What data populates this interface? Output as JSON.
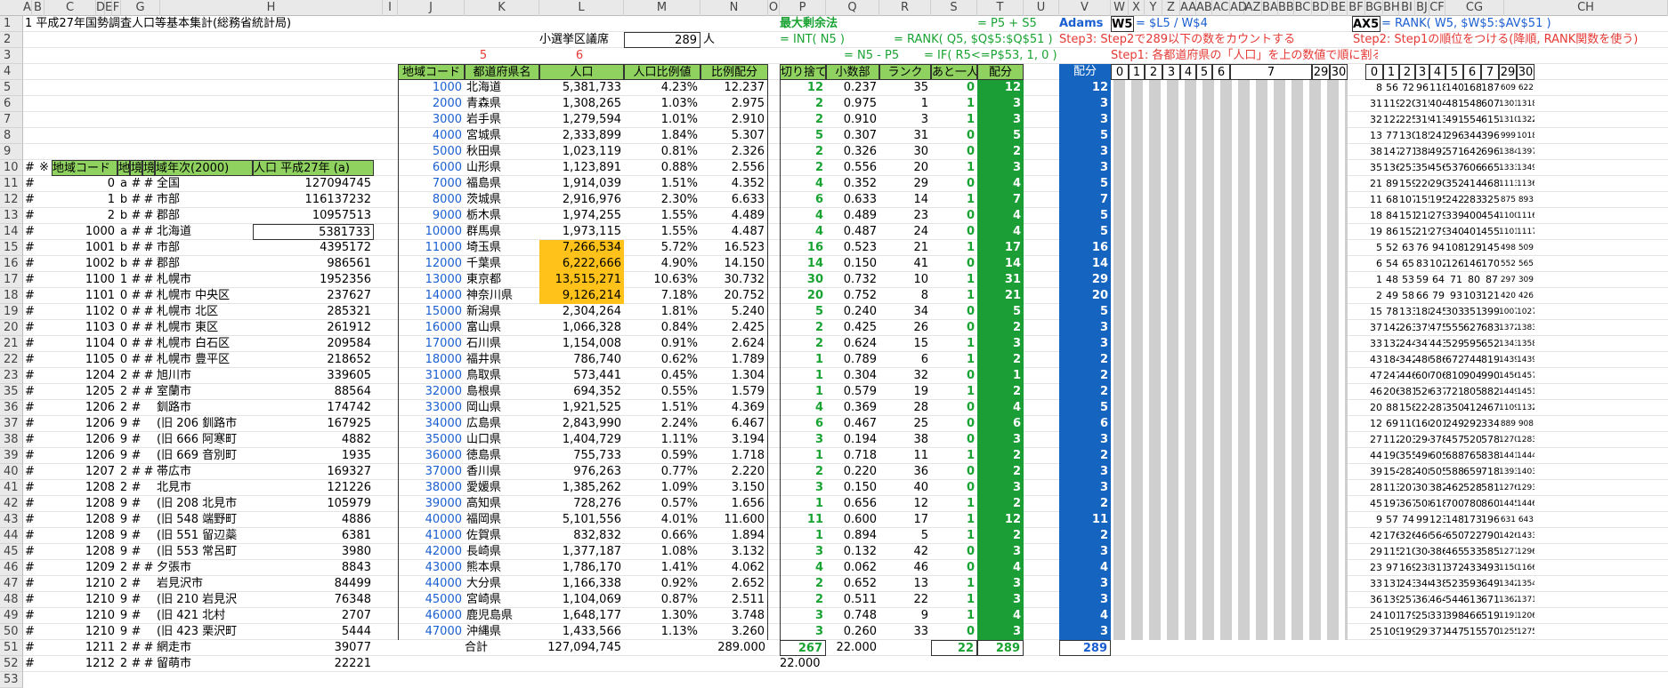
{
  "colheaders": [
    "A",
    "B",
    "C",
    "D",
    "E",
    "F",
    "G",
    "H",
    "I",
    "J",
    "K",
    "L",
    "M",
    "N",
    "O",
    "P",
    "Q",
    "R",
    "S",
    "T",
    "U",
    "V",
    "W",
    "X",
    "Y",
    "Z",
    "AA",
    "AB",
    "AC",
    "AD",
    "AZ",
    "BA",
    "BB",
    "BC",
    "BD",
    "BE",
    "BF",
    "BG",
    "BH",
    "BI",
    "BJ",
    "CF",
    "CG",
    "CH"
  ],
  "rows": [
    "1",
    "2",
    "3",
    "4",
    "5",
    "6",
    "7",
    "8",
    "9",
    "10",
    "11",
    "12",
    "13",
    "14",
    "15",
    "16",
    "17",
    "18",
    "19",
    "20",
    "21",
    "22",
    "23",
    "35",
    "36",
    "37",
    "38",
    "39",
    "40",
    "41",
    "42",
    "43",
    "44",
    "45",
    "46",
    "47",
    "48",
    "49",
    "50",
    "51",
    "52",
    "53"
  ],
  "title": "1  平成27年国勢調査人口等基本集計(総務省統計局)",
  "seat_label": "小選挙区議席",
  "seats": "289",
  "seat_unit": "人",
  "marker5": "5",
  "marker6": "6",
  "tbl_hdr": {
    "code": "地域コード",
    "pref": "都道府県名",
    "pop": "人口",
    "ratio": "人口比例値",
    "prop": "比例配分",
    "floor": "切り捨て",
    "frac": "小数部",
    "rank": "ランク",
    "more": "あと一人？",
    "alloc": "配分",
    "adams": "配分"
  },
  "sec_max": "最大剰余法",
  "f_p5s5": "= P5 + S5",
  "f_int": "= INT( N5 )",
  "f_rank": "= RANK( Q5, $Q$5:$Q$51 )",
  "f_n5p5": "= N5 - P5",
  "f_if": "= IF( R5<=P$53, 1, 0 )",
  "adams_label": "Adams",
  "w5": "W5",
  "f_w5": "= $L5 / W$4",
  "ax5": "AX5",
  "f_ax5": "= RANK( W5, $W$5:$AV$51 )",
  "step3": "Step3: Step2で289以下の数をカウントする",
  "step2": "Step2: Step1の順位をつける(降順, RANK関数を使う)",
  "step1": "Step1: 各都道府県の「人口」を上の数値で順に割る",
  "left_hdr": {
    "note": "※",
    "code": "地域コード",
    "a": "地",
    "b": "境",
    "c": "境",
    "year": "域年次(2000)",
    "pop": "人口 平成27年 (a)"
  },
  "left_rows": [
    [
      "#",
      "",
      "",
      "",
      "",
      "",
      ""
    ],
    [
      "#",
      "0",
      "a",
      "#",
      "#",
      "全国",
      "127094745"
    ],
    [
      "#",
      "1",
      "b",
      "#",
      "#",
      "市部",
      "116137232"
    ],
    [
      "#",
      "2",
      "b",
      "#",
      "#",
      "郡部",
      "10957513"
    ],
    [
      "#",
      "1000",
      "a",
      "#",
      "#",
      "北海道",
      "5381733"
    ],
    [
      "#",
      "1001",
      "b",
      "#",
      "#",
      "市部",
      "4395172"
    ],
    [
      "#",
      "1002",
      "b",
      "#",
      "#",
      "郡部",
      "986561"
    ],
    [
      "#",
      "1100",
      "1",
      "#",
      "#",
      "札幌市",
      "1952356"
    ],
    [
      "#",
      "1101",
      "0",
      "#",
      "#",
      "札幌市 中央区",
      "237627"
    ],
    [
      "#",
      "1102",
      "0",
      "#",
      "#",
      "札幌市 北区",
      "285321"
    ],
    [
      "#",
      "1103",
      "0",
      "#",
      "#",
      "札幌市 東区",
      "261912"
    ],
    [
      "#",
      "1104",
      "0",
      "#",
      "#",
      "札幌市 白石区",
      "209584"
    ],
    [
      "#",
      "1105",
      "0",
      "#",
      "#",
      "札幌市 豊平区",
      "218652"
    ],
    [
      "#",
      "1204",
      "2",
      "#",
      "#",
      "旭川市",
      "339605"
    ],
    [
      "#",
      "1205",
      "2",
      "#",
      "#",
      "室蘭市",
      "88564"
    ],
    [
      "#",
      "1206",
      "2",
      "#",
      "",
      "釧路市",
      "174742"
    ],
    [
      "#",
      "1206",
      "9",
      "#",
      "",
      "(旧 206 釧路市",
      "167925"
    ],
    [
      "#",
      "1206",
      "9",
      "#",
      "",
      "(旧 666 阿寒町",
      "4882"
    ],
    [
      "#",
      "1206",
      "9",
      "#",
      "",
      "(旧 669 音別町",
      "1935"
    ],
    [
      "#",
      "1207",
      "2",
      "#",
      "#",
      "帯広市",
      "169327"
    ],
    [
      "#",
      "1208",
      "2",
      "#",
      "",
      "北見市",
      "121226"
    ],
    [
      "#",
      "1208",
      "9",
      "#",
      "",
      "(旧 208 北見市",
      "105979"
    ],
    [
      "#",
      "1208",
      "9",
      "#",
      "",
      "(旧 548 端野町",
      "4886"
    ],
    [
      "#",
      "1208",
      "9",
      "#",
      "",
      "(旧 551 留辺蘂",
      "6381"
    ],
    [
      "#",
      "1208",
      "9",
      "#",
      "",
      "(旧 553 常呂町",
      "3980"
    ],
    [
      "#",
      "1209",
      "2",
      "#",
      "#",
      "夕張市",
      "8843"
    ],
    [
      "#",
      "1210",
      "2",
      "#",
      "",
      "岩見沢市",
      "84499"
    ],
    [
      "#",
      "1210",
      "9",
      "#",
      "",
      "(旧 210 岩見沢",
      "76348"
    ],
    [
      "#",
      "1210",
      "9",
      "#",
      "",
      "(旧 421 北村",
      "2707"
    ],
    [
      "#",
      "1210",
      "9",
      "#",
      "",
      "(旧 423 栗沢町",
      "5444"
    ],
    [
      "#",
      "1211",
      "2",
      "#",
      "#",
      "網走市",
      "39077"
    ],
    [
      "#",
      "1212",
      "2",
      "#",
      "#",
      "留萌市",
      "22221"
    ]
  ],
  "prefs": [
    [
      "1000",
      "北海道",
      "5,381,733",
      "4.23%",
      "12.237",
      "12",
      "0.237",
      "35",
      "0",
      "12",
      "12"
    ],
    [
      "2000",
      "青森県",
      "1,308,265",
      "1.03%",
      "2.975",
      "2",
      "0.975",
      "1",
      "1",
      "3",
      "3"
    ],
    [
      "3000",
      "岩手県",
      "1,279,594",
      "1.01%",
      "2.910",
      "2",
      "0.910",
      "3",
      "1",
      "3",
      "3"
    ],
    [
      "4000",
      "宮城県",
      "2,333,899",
      "1.84%",
      "5.307",
      "5",
      "0.307",
      "31",
      "0",
      "5",
      "5"
    ],
    [
      "5000",
      "秋田県",
      "1,023,119",
      "0.81%",
      "2.326",
      "2",
      "0.326",
      "30",
      "0",
      "2",
      "3"
    ],
    [
      "6000",
      "山形県",
      "1,123,891",
      "0.88%",
      "2.556",
      "2",
      "0.556",
      "20",
      "1",
      "3",
      "3"
    ],
    [
      "7000",
      "福島県",
      "1,914,039",
      "1.51%",
      "4.352",
      "4",
      "0.352",
      "29",
      "0",
      "4",
      "5"
    ],
    [
      "8000",
      "茨城県",
      "2,916,976",
      "2.30%",
      "6.633",
      "6",
      "0.633",
      "14",
      "1",
      "7",
      "7"
    ],
    [
      "9000",
      "栃木県",
      "1,974,255",
      "1.55%",
      "4.489",
      "4",
      "0.489",
      "23",
      "0",
      "4",
      "5"
    ],
    [
      "10000",
      "群馬県",
      "1,973,115",
      "1.55%",
      "4.487",
      "4",
      "0.487",
      "24",
      "0",
      "4",
      "5"
    ],
    [
      "11000",
      "埼玉県",
      "7,266,534",
      "5.72%",
      "16.523",
      "16",
      "0.523",
      "21",
      "1",
      "17",
      "16"
    ],
    [
      "12000",
      "千葉県",
      "6,222,666",
      "4.90%",
      "14.150",
      "14",
      "0.150",
      "41",
      "0",
      "14",
      "14"
    ],
    [
      "13000",
      "東京都",
      "13,515,271",
      "10.63%",
      "30.732",
      "30",
      "0.732",
      "10",
      "1",
      "31",
      "29"
    ],
    [
      "14000",
      "神奈川県",
      "9,126,214",
      "7.18%",
      "20.752",
      "20",
      "0.752",
      "8",
      "1",
      "21",
      "20"
    ],
    [
      "15000",
      "新潟県",
      "2,304,264",
      "1.81%",
      "5.240",
      "5",
      "0.240",
      "34",
      "0",
      "5",
      "5"
    ],
    [
      "16000",
      "富山県",
      "1,066,328",
      "0.84%",
      "2.425",
      "2",
      "0.425",
      "26",
      "0",
      "2",
      "3"
    ],
    [
      "17000",
      "石川県",
      "1,154,008",
      "0.91%",
      "2.624",
      "2",
      "0.624",
      "15",
      "1",
      "3",
      "3"
    ],
    [
      "18000",
      "福井県",
      "786,740",
      "0.62%",
      "1.789",
      "1",
      "0.789",
      "6",
      "1",
      "2",
      "2"
    ],
    [
      "31000",
      "鳥取県",
      "573,441",
      "0.45%",
      "1.304",
      "1",
      "0.304",
      "32",
      "0",
      "1",
      "2"
    ],
    [
      "32000",
      "島根県",
      "694,352",
      "0.55%",
      "1.579",
      "1",
      "0.579",
      "19",
      "1",
      "2",
      "2"
    ],
    [
      "33000",
      "岡山県",
      "1,921,525",
      "1.51%",
      "4.369",
      "4",
      "0.369",
      "28",
      "0",
      "4",
      "5"
    ],
    [
      "34000",
      "広島県",
      "2,843,990",
      "2.24%",
      "6.467",
      "6",
      "0.467",
      "25",
      "0",
      "6",
      "6"
    ],
    [
      "35000",
      "山口県",
      "1,404,729",
      "1.11%",
      "3.194",
      "3",
      "0.194",
      "38",
      "0",
      "3",
      "3"
    ],
    [
      "36000",
      "徳島県",
      "755,733",
      "0.59%",
      "1.718",
      "1",
      "0.718",
      "11",
      "1",
      "2",
      "2"
    ],
    [
      "37000",
      "香川県",
      "976,263",
      "0.77%",
      "2.220",
      "2",
      "0.220",
      "36",
      "0",
      "2",
      "3"
    ],
    [
      "38000",
      "愛媛県",
      "1,385,262",
      "1.09%",
      "3.150",
      "3",
      "0.150",
      "40",
      "0",
      "3",
      "3"
    ],
    [
      "39000",
      "高知県",
      "728,276",
      "0.57%",
      "1.656",
      "1",
      "0.656",
      "12",
      "1",
      "2",
      "2"
    ],
    [
      "40000",
      "福岡県",
      "5,101,556",
      "4.01%",
      "11.600",
      "11",
      "0.600",
      "17",
      "1",
      "12",
      "11"
    ],
    [
      "41000",
      "佐賀県",
      "832,832",
      "0.66%",
      "1.894",
      "1",
      "0.894",
      "5",
      "1",
      "2",
      "2"
    ],
    [
      "42000",
      "長崎県",
      "1,377,187",
      "1.08%",
      "3.132",
      "3",
      "0.132",
      "42",
      "0",
      "3",
      "3"
    ],
    [
      "43000",
      "熊本県",
      "1,786,170",
      "1.41%",
      "4.062",
      "4",
      "0.062",
      "46",
      "0",
      "4",
      "4"
    ],
    [
      "44000",
      "大分県",
      "1,166,338",
      "0.92%",
      "2.652",
      "2",
      "0.652",
      "13",
      "1",
      "3",
      "3"
    ],
    [
      "45000",
      "宮崎県",
      "1,104,069",
      "0.87%",
      "2.511",
      "2",
      "0.511",
      "22",
      "1",
      "3",
      "3"
    ],
    [
      "46000",
      "鹿児島県",
      "1,648,177",
      "1.30%",
      "3.748",
      "3",
      "0.748",
      "9",
      "1",
      "4",
      "4"
    ],
    [
      "47000",
      "沖縄県",
      "1,433,566",
      "1.13%",
      "3.260",
      "3",
      "0.260",
      "33",
      "0",
      "3",
      "3"
    ]
  ],
  "totals": {
    "label": "合計",
    "pop": "127,094,745",
    "prop": "289.000",
    "floor": "267",
    "frac": "22.000",
    "more": "22",
    "alloc": "289",
    "adams": "289",
    "p53": "22.000"
  },
  "w_hdr": [
    "0",
    "1",
    "2",
    "3",
    "4",
    "5",
    "6",
    "7",
    "29",
    "30"
  ],
  "bd_hdr": [
    "0",
    "1",
    "2",
    "3",
    "4",
    "5",
    "6",
    "7",
    "29",
    "30"
  ],
  "bd_rows": [
    [
      "8",
      "56",
      "72",
      "96",
      "118",
      "140",
      "168",
      "187",
      "609",
      "622"
    ],
    [
      "31",
      "119",
      "220",
      "315",
      "404",
      "481",
      "548",
      "607",
      "1301",
      "1318"
    ],
    [
      "32",
      "122",
      "225",
      "319",
      "413",
      "491",
      "554",
      "615",
      "1310",
      "1322"
    ],
    [
      "13",
      "77",
      "130",
      "185",
      "241",
      "296",
      "344",
      "396",
      "999",
      "1018"
    ],
    [
      "38",
      "147",
      "271",
      "388",
      "492",
      "571",
      "642",
      "696",
      "1384",
      "1397"
    ],
    [
      "35",
      "136",
      "253",
      "356",
      "456",
      "537",
      "606",
      "665",
      "1333",
      "1349"
    ],
    [
      "21",
      "89",
      "159",
      "226",
      "290",
      "352",
      "414",
      "468",
      "1113",
      "1136"
    ],
    [
      "11",
      "68",
      "107",
      "155",
      "195",
      "242",
      "283",
      "325",
      "875",
      "893"
    ],
    [
      "18",
      "84",
      "151",
      "218",
      "279",
      "339",
      "400",
      "454",
      "1100",
      "1116"
    ],
    [
      "19",
      "86",
      "152",
      "219",
      "279",
      "340",
      "401",
      "455",
      "1101",
      "1117"
    ],
    [
      "5",
      "52",
      "63",
      "76",
      "94",
      "108",
      "129",
      "145",
      "498",
      "509"
    ],
    [
      "6",
      "54",
      "65",
      "83",
      "102",
      "126",
      "146",
      "170",
      "552",
      "565"
    ],
    [
      "1",
      "48",
      "53",
      "59",
      "64",
      "71",
      "80",
      "87",
      "297",
      "309"
    ],
    [
      "2",
      "49",
      "58",
      "66",
      "79",
      "93",
      "103",
      "121",
      "420",
      "426"
    ],
    [
      "15",
      "78",
      "133",
      "188",
      "245",
      "303",
      "351",
      "399",
      "1007",
      "1027"
    ],
    [
      "37",
      "142",
      "263",
      "375",
      "475",
      "555",
      "627",
      "683",
      "1372",
      "1383"
    ],
    [
      "33",
      "132",
      "244",
      "347",
      "443",
      "529",
      "595",
      "652",
      "1343",
      "1358"
    ],
    [
      "43",
      "184",
      "342",
      "480",
      "586",
      "672",
      "744",
      "819",
      "1439",
      "1439"
    ],
    [
      "47",
      "247",
      "446",
      "600",
      "706",
      "810",
      "904",
      "990",
      "1456",
      "1457"
    ],
    [
      "46",
      "206",
      "381",
      "526",
      "637",
      "721",
      "805",
      "882",
      "1449",
      "1451"
    ],
    [
      "20",
      "88",
      "158",
      "224",
      "287",
      "350",
      "412",
      "467",
      "1109",
      "1132"
    ],
    [
      "12",
      "69",
      "110",
      "160",
      "201",
      "249",
      "292",
      "334",
      "889",
      "908"
    ],
    [
      "27",
      "112",
      "203",
      "294",
      "378",
      "457",
      "520",
      "578",
      "1270",
      "1283"
    ],
    [
      "44",
      "190",
      "355",
      "496",
      "605",
      "688",
      "765",
      "838",
      "1441",
      "1444"
    ],
    [
      "39",
      "154",
      "282",
      "408",
      "505",
      "588",
      "659",
      "718",
      "1393",
      "1403"
    ],
    [
      "28",
      "113",
      "207",
      "301",
      "382",
      "462",
      "528",
      "581",
      "1276",
      "1293"
    ],
    [
      "45",
      "197",
      "367",
      "508",
      "618",
      "700",
      "780",
      "860",
      "1445",
      "1446"
    ],
    [
      "9",
      "57",
      "74",
      "99",
      "123",
      "148",
      "173",
      "196",
      "631",
      "643"
    ],
    [
      "42",
      "176",
      "326",
      "460",
      "564",
      "650",
      "722",
      "790",
      "1426",
      "1433"
    ],
    [
      "29",
      "115",
      "210",
      "304",
      "386",
      "465",
      "533",
      "585",
      "1277",
      "1296"
    ],
    [
      "23",
      "97",
      "169",
      "238",
      "311",
      "372",
      "433",
      "493",
      "1150",
      "1166"
    ],
    [
      "33",
      "131",
      "243",
      "346",
      "438",
      "523",
      "593",
      "649",
      "1342",
      "1354"
    ],
    [
      "36",
      "139",
      "257",
      "362",
      "464",
      "544",
      "613",
      "671",
      "1362",
      "1371"
    ],
    [
      "24",
      "101",
      "179",
      "258",
      "331",
      "398",
      "466",
      "519",
      "1191",
      "1206"
    ],
    [
      "25",
      "109",
      "199",
      "291",
      "371",
      "447",
      "515",
      "570",
      "1255",
      "1275"
    ]
  ]
}
